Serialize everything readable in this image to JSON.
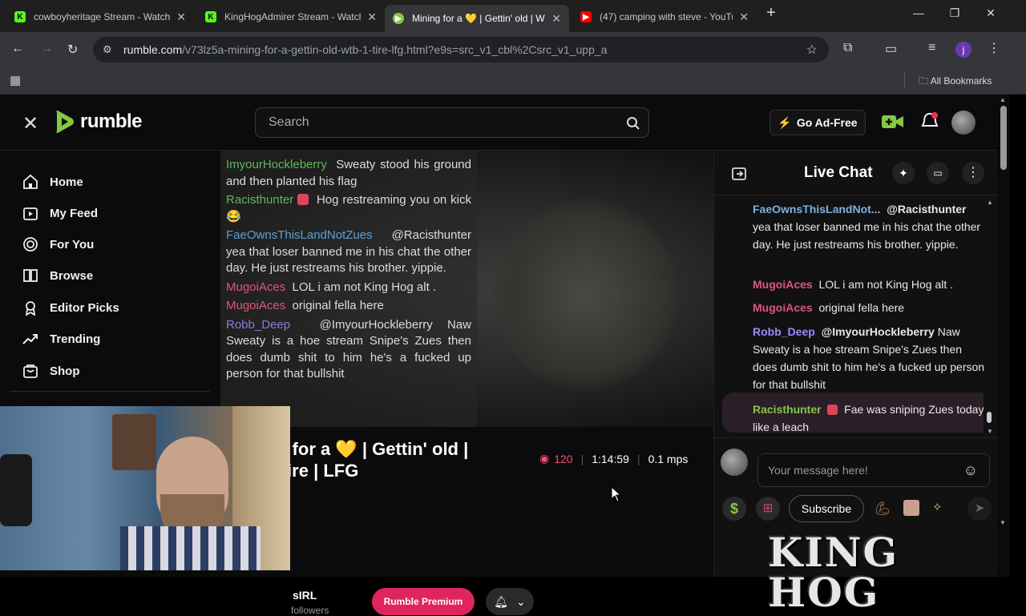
{
  "browser": {
    "tabs": [
      {
        "title": "cowboyheritage Stream - Watch",
        "icon": "kick-icon",
        "color": "#53fc18"
      },
      {
        "title": "KingHogAdmirer Stream - Watch",
        "icon": "kick-icon",
        "color": "#53fc18"
      },
      {
        "title": "Mining for a 💛 | Gettin' old | W",
        "icon": "rumble-icon",
        "color": "#85c742"
      },
      {
        "title": "(47) camping with steve - YouTu",
        "icon": "youtube-icon",
        "color": "#ff0000"
      }
    ],
    "url_host": "rumble.com",
    "url_path": "/v73lz5a-mining-for-a-gettin-old-wtb-1-tire-lfg.html?e9s=src_v1_cbl%2Csrc_v1_upp_a",
    "bookmarks_label": "All Bookmarks",
    "profile_initial": "j"
  },
  "site": {
    "logo_text": "rumble",
    "search_placeholder": "Search",
    "ad_free_label": "Go Ad-Free",
    "brand_color": "#85c742"
  },
  "sidebar": {
    "items": [
      {
        "label": "Home",
        "icon": "home-icon"
      },
      {
        "label": "My Feed",
        "icon": "feed-icon"
      },
      {
        "label": "For You",
        "icon": "for-you-icon"
      },
      {
        "label": "Browse",
        "icon": "browse-icon"
      },
      {
        "label": "Editor Picks",
        "icon": "editor-picks-icon"
      },
      {
        "label": "Trending",
        "icon": "trending-icon"
      },
      {
        "label": "Shop",
        "icon": "shop-icon"
      }
    ]
  },
  "overlay_chat": [
    {
      "user": "ImyourHockleberry",
      "color": "#5fb85a",
      "text": "Sweaty stood his ground and then planted his flag"
    },
    {
      "user": "Racisthunter",
      "color": "#5fb85a",
      "badge": true,
      "text": "Hog restreaming you on kick😂"
    },
    {
      "user": "FaeOwnsThisLandNotZues",
      "color": "#5aa0d8",
      "text": "@Racisthunter yea that loser banned me in his chat the other day. He just restreams his brother. yippie."
    },
    {
      "user": "MugoiAces",
      "color": "#e0567a",
      "text": "LOL i am not King Hog alt ."
    },
    {
      "user": "MugoiAces",
      "color": "#e0567a",
      "text": "original fella here"
    },
    {
      "user": "Robb_Deep",
      "color": "#8a7bdc",
      "text": "@ImyourHockleberry Naw Sweaty is a hoe stream Snipe's Zues then does dumb shit to him he's a fucked up person for that bullshit"
    }
  ],
  "video_info": {
    "title_line1": "g for a 💛 | Gettin' old |",
    "title_line2": "Tire | LFG",
    "viewers": "120",
    "duration": "1:14:59",
    "mps": "0.1 mps",
    "channel_partial": "sIRL",
    "followers_partial": "followers",
    "premium_label": "Rumble Premium"
  },
  "live_chat": {
    "title": "Live Chat",
    "messages": [
      {
        "user": "FaeOwnsThisLandNot...",
        "user_color": "#7fb0e0",
        "mention": "@Racisthunter",
        "text": "yea that loser banned me in his chat the other day. He just restreams his brother. yippie."
      },
      {
        "user": "MugoiAces",
        "user_color": "#e0567a",
        "mention": "",
        "text": "LOL i am not King Hog alt ."
      },
      {
        "user": "MugoiAces",
        "user_color": "#e0567a",
        "mention": "",
        "text": "original fella here"
      },
      {
        "user": "Robb_Deep",
        "user_color": "#9a8cff",
        "mention": "@ImyourHockleberry",
        "text": "Naw Sweaty is a hoe stream Snipe's Zues then does dumb shit to him he's a fucked up person for that bullshit"
      },
      {
        "user": "Racisthunter",
        "user_color": "#85c742",
        "mention": "",
        "text": "Fae was sniping Zues today like a leach",
        "badge": true
      }
    ],
    "input_placeholder": "Your message here!",
    "subscribe_label": "Subscribe"
  },
  "watermark": "KING HOG"
}
